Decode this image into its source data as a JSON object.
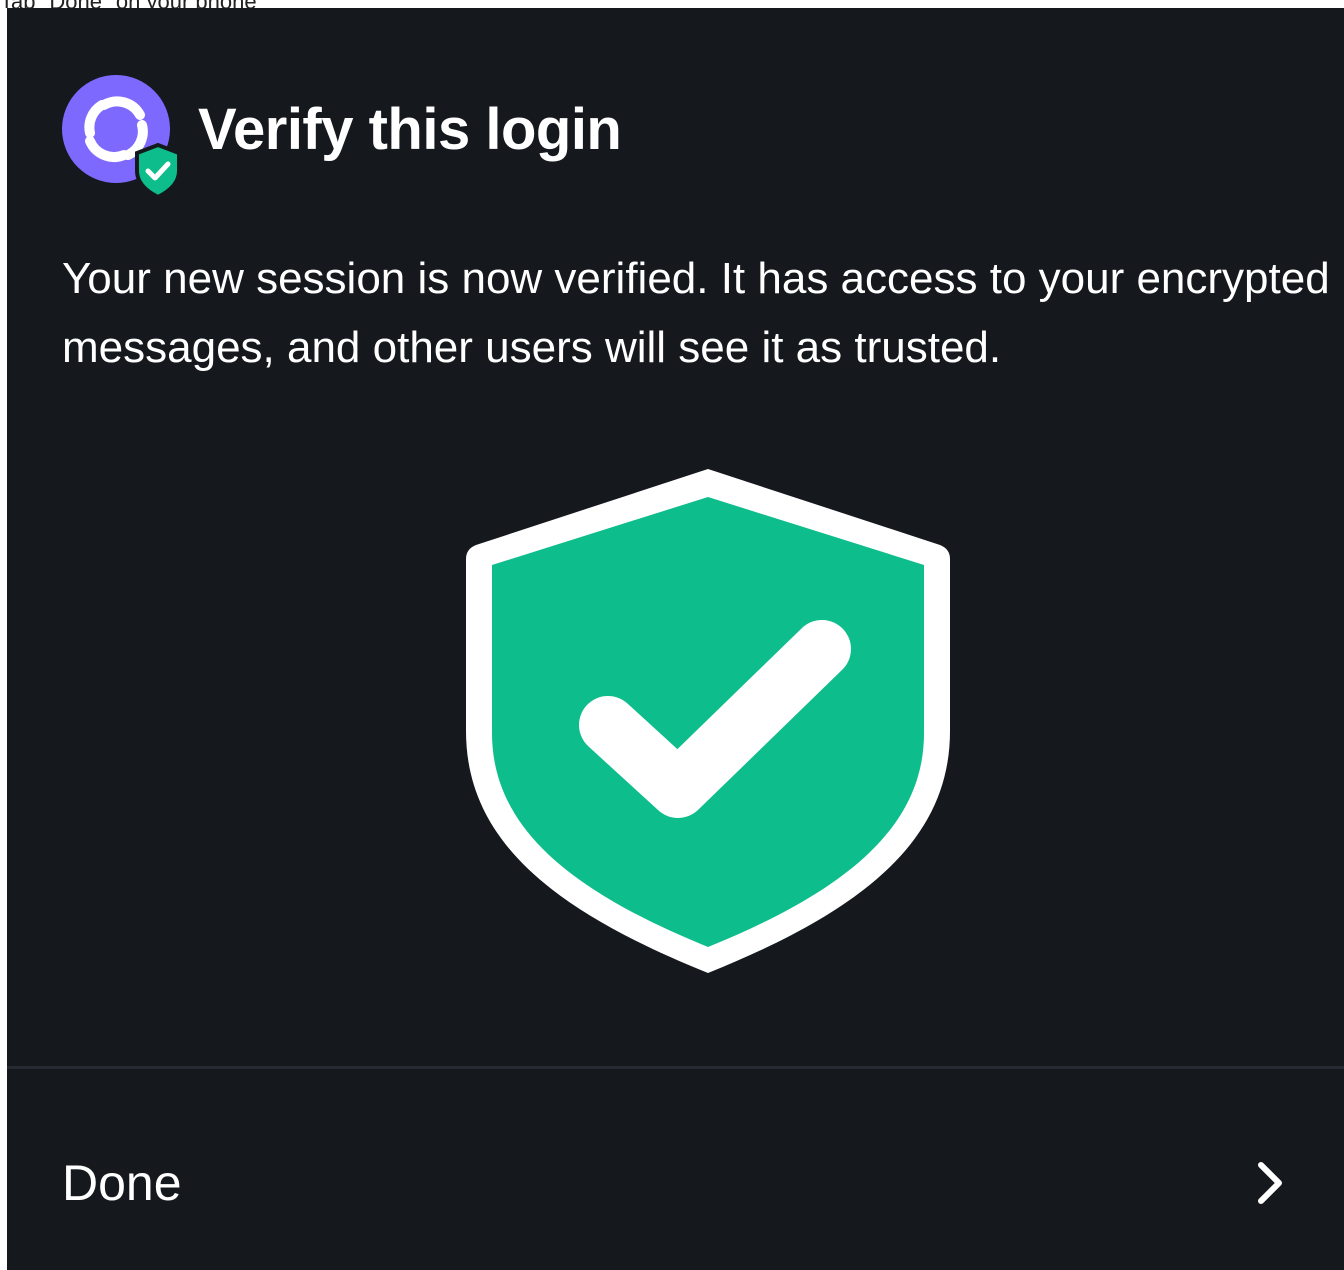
{
  "caption": {
    "text": "Tap \"Done\" on your phone"
  },
  "header": {
    "title": "Verify this login",
    "app_icon": "element-logo-icon",
    "badge_icon": "verified-shield-badge-icon"
  },
  "description": "Your new session is now verified. It has access to your encrypted messages, and other users will see it as trusted.",
  "illustration": {
    "icon": "verified-shield-check-icon"
  },
  "done_row": {
    "label": "Done",
    "icon": "chevron-right-icon"
  },
  "colors": {
    "background": "#15191e",
    "avatar": "#7e69ff",
    "accent_green": "#0dbd8b",
    "text": "#ffffff",
    "divider": "#262b33"
  }
}
